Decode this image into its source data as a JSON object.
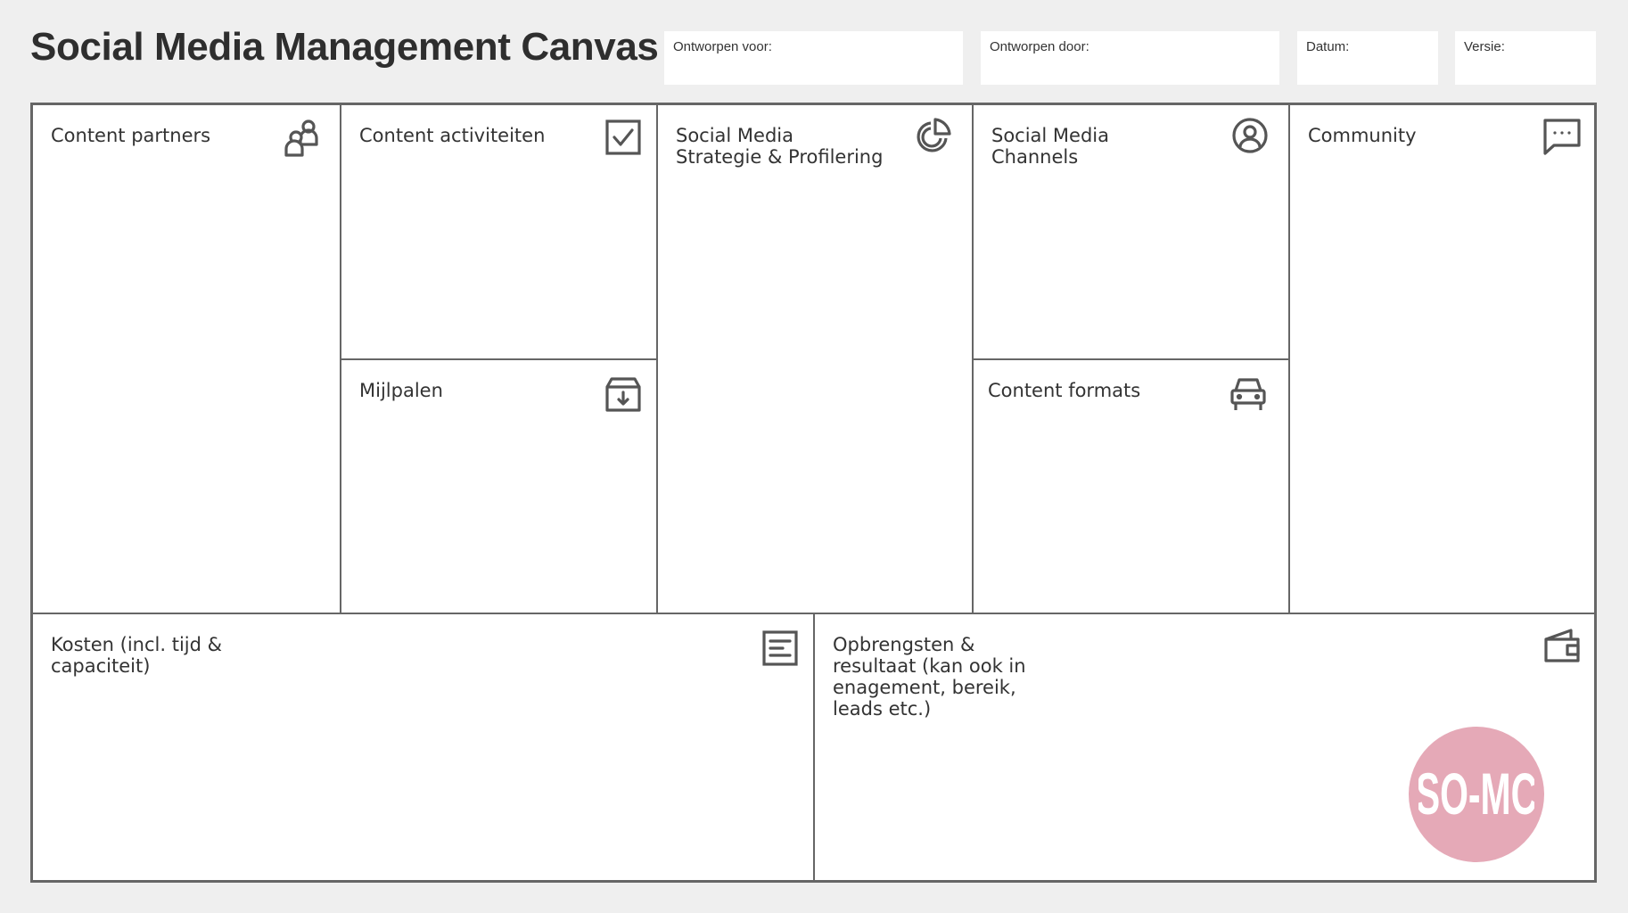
{
  "title": "Social Media Management Canvas",
  "meta": {
    "designed_for": "Ontworpen voor:",
    "designed_by": "Ontworpen door:",
    "date": "Datum:",
    "version": "Versie:"
  },
  "cells": {
    "content_partners": {
      "label": "Content partners",
      "icon": "users-icon"
    },
    "content_activities": {
      "label": "Content activiteiten",
      "icon": "checkbox-icon"
    },
    "milestones": {
      "label": "Mijlpalen",
      "icon": "archive-download-icon"
    },
    "strategy": {
      "label": "Social Media\nStrategie & Profilering",
      "icon": "pie-chart-icon"
    },
    "channels": {
      "label": "Social Media\nChannels",
      "icon": "user-circle-icon"
    },
    "formats": {
      "label": "Content formats",
      "icon": "car-icon"
    },
    "community": {
      "label": "Community",
      "icon": "chat-bubble-icon"
    },
    "costs": {
      "label": "Kosten (incl. tijd &\ncapaciteit)",
      "icon": "document-lines-icon"
    },
    "revenue": {
      "label": "Opbrengsten &\nresultaat (kan ook in\nenagement, bereik,\nleads etc.)",
      "icon": "wallet-icon"
    }
  },
  "logo": {
    "text": "SO-MC",
    "color": "#e5a9b7"
  },
  "colors": {
    "background": "#efefef",
    "border": "#666666",
    "text": "#2f2f2f"
  }
}
